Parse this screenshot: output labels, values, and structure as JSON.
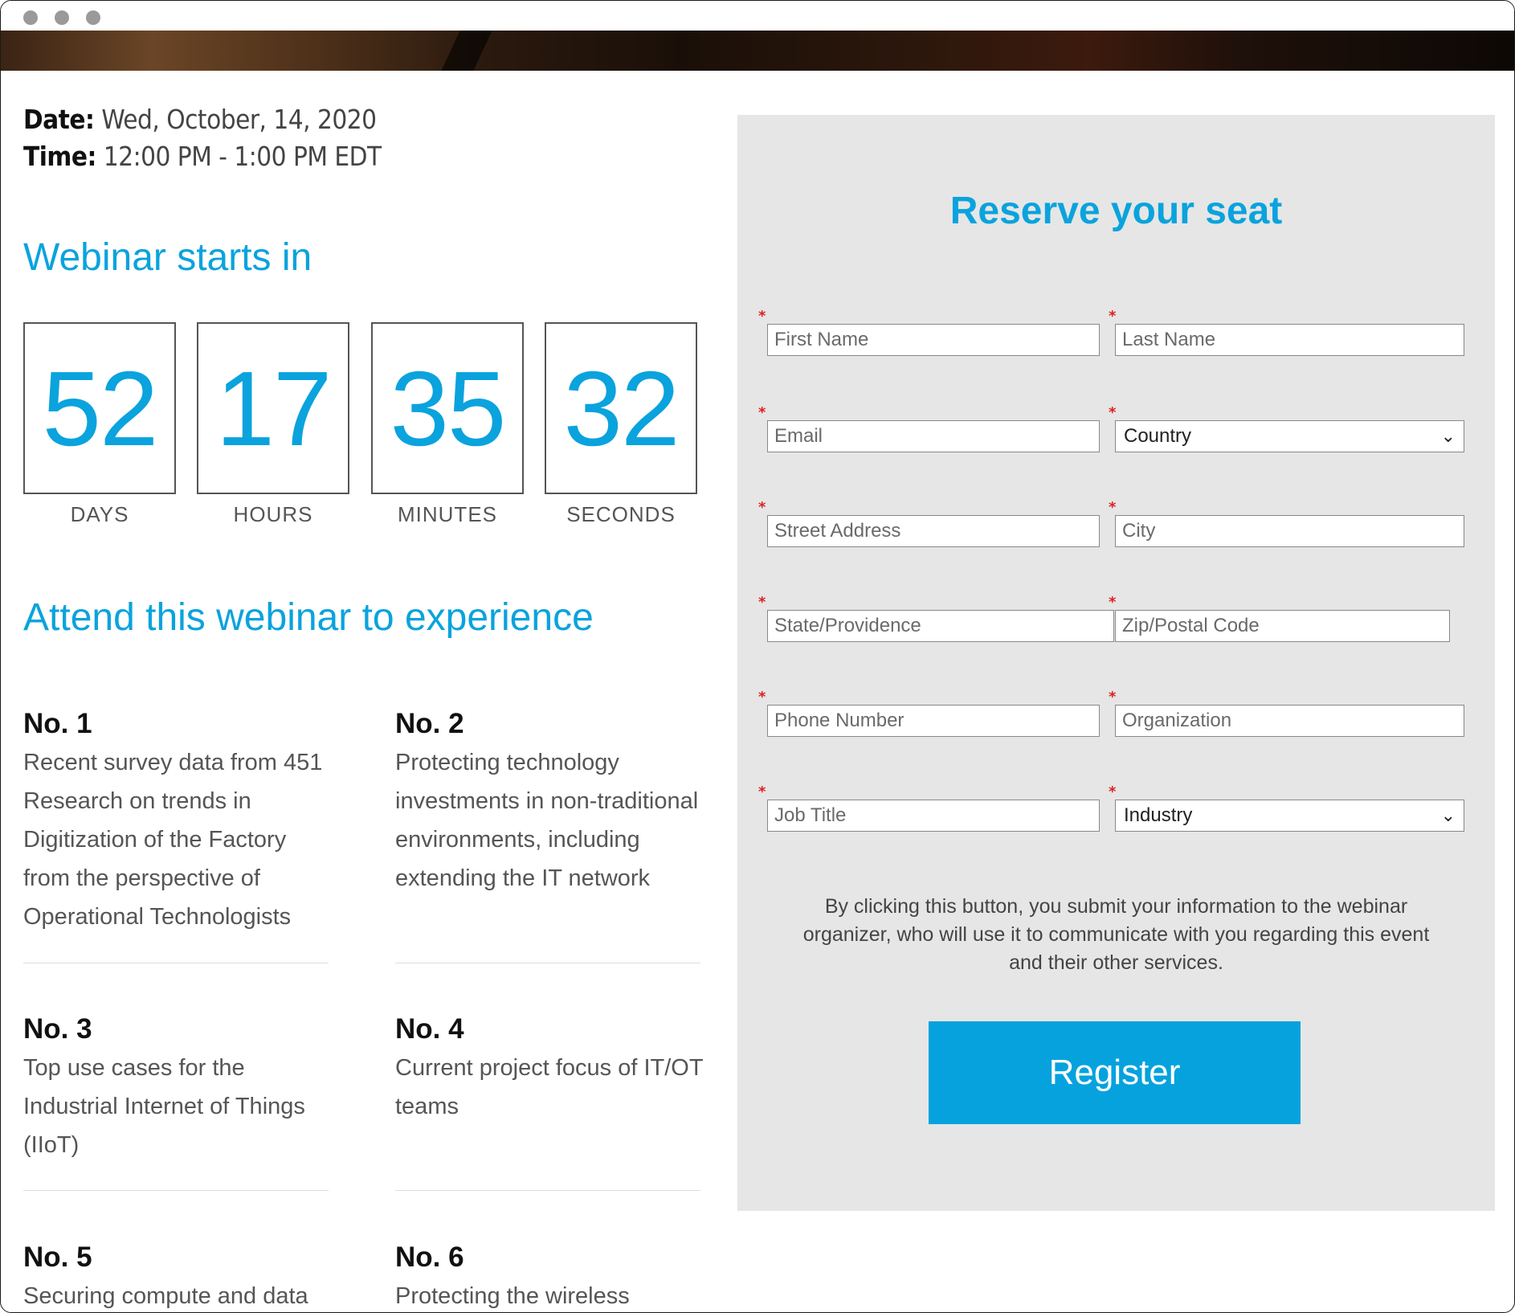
{
  "event": {
    "date_label": "Date:",
    "date_value": "Wed, October, 14, 2020",
    "time_label": "Time:",
    "time_value": "12:00 PM - 1:00 PM EDT"
  },
  "countdown": {
    "heading": "Webinar starts in",
    "units": [
      {
        "value": "52",
        "label": "DAYS"
      },
      {
        "value": "17",
        "label": "HOURS"
      },
      {
        "value": "35",
        "label": "MINUTES"
      },
      {
        "value": "32",
        "label": "SECONDS"
      }
    ]
  },
  "benefits": {
    "heading": "Attend this webinar to experience",
    "items": [
      {
        "number": "No. 1",
        "text": "Recent survey data from 451 Research on trends in Digitization of the Factory from the perspective of Operational Technologists"
      },
      {
        "number": "No. 2",
        "text": "Protecting technology investments in non-traditional environments, including extending the IT network"
      },
      {
        "number": "No. 3",
        "text": "Top use cases for the Industrial Internet of Things (IIoT)"
      },
      {
        "number": "No. 4",
        "text": "Current project focus of IT/OT teams"
      },
      {
        "number": "No. 5",
        "text": "Securing compute and data"
      },
      {
        "number": "No. 6",
        "text": "Protecting the wireless"
      }
    ]
  },
  "form": {
    "title": "Reserve your seat",
    "required_mark": "*",
    "fields": {
      "first_name": "First Name",
      "last_name": "Last Name",
      "email": "Email",
      "country": "Country",
      "street": "Street Address",
      "city": "City",
      "state": "State/Providence",
      "zip": "Zip/Postal Code",
      "phone": "Phone Number",
      "organization": "Organization",
      "job_title": "Job Title",
      "industry": "Industry"
    },
    "select_icon": "chevron-down-icon",
    "disclaimer": "By clicking this button, you submit your information to the webinar organizer, who will use it to communicate with you regarding this event and their other services.",
    "submit_label": "Register"
  },
  "colors": {
    "accent": "#0aa3dd",
    "button": "#06a2de",
    "panel": "#e6e6e6",
    "required": "#e02020"
  }
}
